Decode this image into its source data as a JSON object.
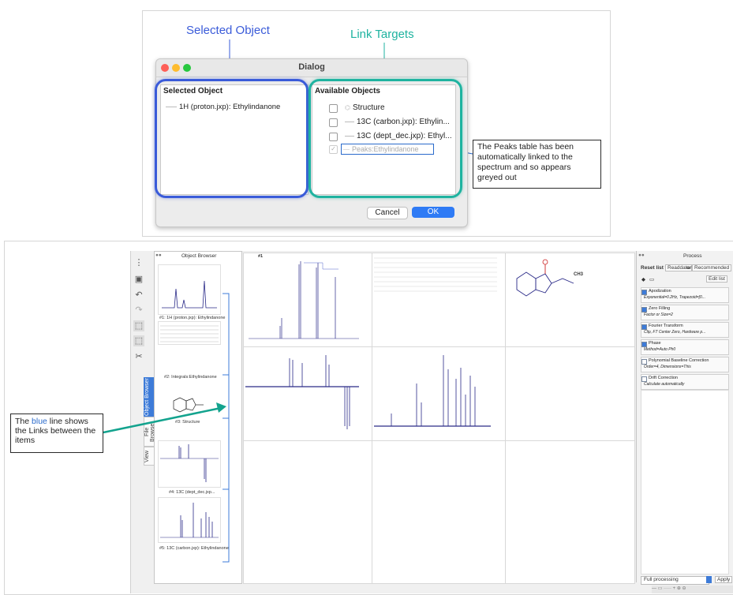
{
  "callouts": {
    "selected_object": "Selected Object",
    "link_targets": "Link Targets",
    "peaks_note": "The Peaks table has been automatically linked to the spectrum and so appears greyed out",
    "blue_note_pre": "The ",
    "blue_note_word": "blue",
    "blue_note_post": " line shows the Links between the items"
  },
  "colors": {
    "selected_blue": "#3a5bd9",
    "link_teal": "#1fb3a0",
    "ok_blue": "#2f7bf5",
    "spectrum_navy": "#2a2a88",
    "link_line": "#3d7bd8"
  },
  "dialog": {
    "title": "Dialog",
    "left_panel": {
      "header": "Selected Object",
      "item": "1H (proton.jxp): Ethylindanone"
    },
    "right_panel": {
      "header": "Available Objects",
      "items": [
        {
          "label": "Structure",
          "checked": false,
          "disabled": false
        },
        {
          "label": "13C (carbon.jxp): Ethylin...",
          "checked": false,
          "disabled": false
        },
        {
          "label": "13C (dept_dec.jxp): Ethyl...",
          "checked": false,
          "disabled": false
        },
        {
          "label": "Peaks:Ethylindanone",
          "checked": true,
          "disabled": true
        }
      ]
    },
    "cancel_label": "Cancel",
    "ok_label": "OK"
  },
  "app": {
    "object_browser_title": "Object Browser",
    "vertical_tabs": [
      "Object Browser",
      "File Browser",
      "View"
    ],
    "thumbnails": [
      "#1: 1H (proton.jxp): Ethylindanone",
      "#2: Integrals:Ethylindanone",
      "#3: Structure",
      "#4: 13C (dept_dec.jxp...",
      "#5: 13C (carbon.jxp): Ethylindanone"
    ],
    "cell_tag": "#1",
    "structure_label": "CH3",
    "process": {
      "title": "Process",
      "reset_label": "Reset list to",
      "readdata_label": "Readdata",
      "or_label": "or",
      "recommended_label": "Recommended",
      "edit_list_label": "Edit list",
      "items": [
        {
          "name": "Apodization",
          "desc": "Exponential=0.2Hz, Trapezoid=[0...",
          "checked": true
        },
        {
          "name": "Zero Filling",
          "desc": "Factor or Size=2",
          "checked": true
        },
        {
          "name": "Fourier Transform",
          "desc": "Clip, FT Center Zero, Hardware p...",
          "checked": true
        },
        {
          "name": "Phase",
          "desc": "Method=Auto Ph0",
          "checked": true
        },
        {
          "name": "Polynomial Baseline Correction",
          "desc": "Order=4, Dimensions=This",
          "checked": false
        },
        {
          "name": "Drift Correction",
          "desc": "Calculate automatically",
          "checked": false
        }
      ],
      "footer_select": "Full processing",
      "apply_label": "Apply"
    }
  }
}
